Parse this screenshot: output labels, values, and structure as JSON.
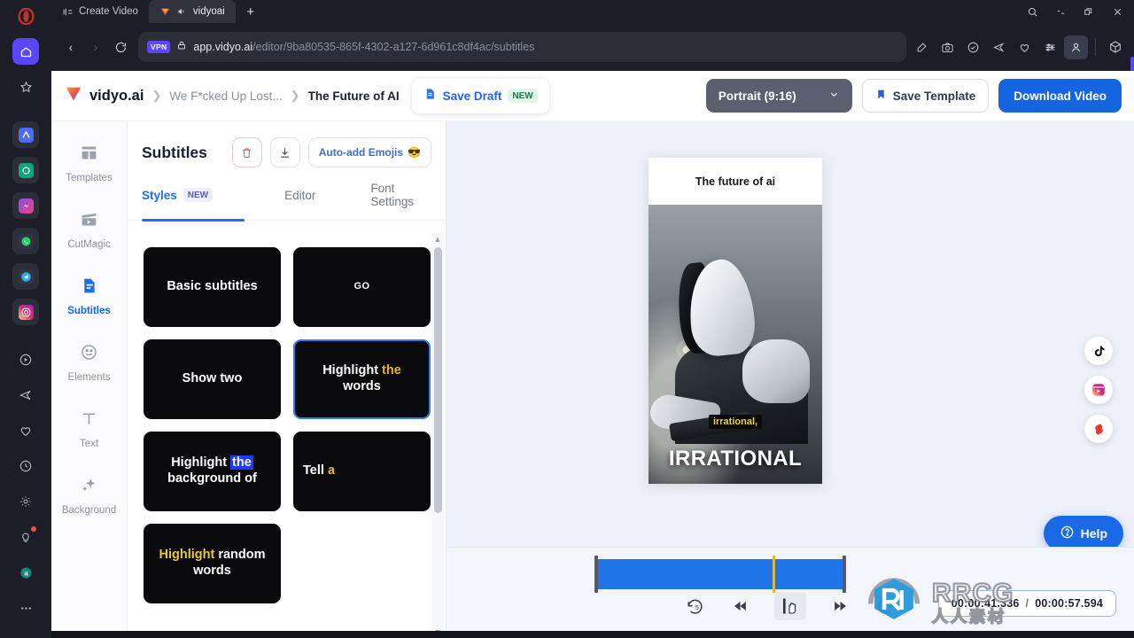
{
  "browser": {
    "tabs": [
      {
        "label": "Create Video",
        "active": false,
        "icon": "media-tab-icon"
      },
      {
        "label": "vidyoai",
        "active": true,
        "icon": "vidyo-favicon"
      }
    ],
    "new_tab_label": "+",
    "window_controls": [
      "search-icon",
      "minimize-icon",
      "maximize-icon",
      "close-icon"
    ],
    "nav": {
      "back": "‹",
      "forward": "›",
      "reload": "reload-icon"
    },
    "vpn_badge": "VPN",
    "url_host": "app.vidyo.ai",
    "url_path": "/editor/9ba80535-865f-4302-a127-6d961c8df4ac/subtitles",
    "toolbar_icons": [
      "edit-icon",
      "camera-icon",
      "shield-check-icon",
      "send-icon",
      "heart-icon",
      "sliders-icon",
      "profile-icon",
      "extensions-cube-icon"
    ],
    "sidebar_icons": [
      "opera-logo-icon",
      "home-icon",
      "star-icon",
      "pinned-app-icon",
      "chatgpt-icon",
      "messenger-icon",
      "whatsapp-icon",
      "telegram-icon",
      "instagram-icon",
      "player-icon",
      "send-icon",
      "heart-icon",
      "history-clock-icon",
      "settings-gear-icon",
      "tips-bulb-icon",
      "aria-icon",
      "more-dots-icon"
    ]
  },
  "header": {
    "brand": "vidyo.ai",
    "breadcrumb": [
      "We F*cked Up Lost...",
      "The Future of AI"
    ],
    "save_draft": "Save Draft",
    "save_draft_badge": "NEW",
    "ratio": "Portrait (9:16)",
    "save_template": "Save Template",
    "download_video": "Download Video"
  },
  "tools": [
    {
      "label": "Templates",
      "icon": "layout-grid-icon",
      "active": false
    },
    {
      "label": "CutMagic",
      "icon": "clapperboard-icon",
      "active": false
    },
    {
      "label": "Subtitles",
      "icon": "subtitles-doc-icon",
      "active": true
    },
    {
      "label": "Elements",
      "icon": "smiley-icon",
      "active": false
    },
    {
      "label": "Text",
      "icon": "text-t-icon",
      "active": false
    },
    {
      "label": "Background",
      "icon": "sparkles-icon",
      "active": false
    }
  ],
  "panel": {
    "title": "Subtitles",
    "delete_icon": "trash-icon",
    "download_icon": "download-icon",
    "emoji_button": "Auto-add Emojis",
    "emoji_glyph": "😎",
    "tabs": [
      {
        "label": "Styles",
        "badge": "NEW",
        "active": true
      },
      {
        "label": "Editor",
        "badge": "",
        "active": false
      },
      {
        "label": "Font Settings",
        "badge": "",
        "active": false
      }
    ],
    "styles": [
      {
        "name": "Basic subtitles",
        "parts": [
          {
            "t": "Basic subtitles",
            "hl": "none"
          }
        ],
        "selected": false,
        "small": false
      },
      {
        "name": "GO",
        "parts": [
          {
            "t": "GO",
            "hl": "none"
          }
        ],
        "selected": false,
        "small": true
      },
      {
        "name": "Show two",
        "parts": [
          {
            "t": "Show two",
            "hl": "none"
          }
        ],
        "selected": false,
        "small": false
      },
      {
        "name": "Highlight the words",
        "parts": [
          {
            "t": "Highlight ",
            "hl": "none"
          },
          {
            "t": "the",
            "hl": "yellow"
          },
          {
            "t": " words",
            "hl": "none"
          }
        ],
        "selected": true,
        "small": false
      },
      {
        "name": "Highlight the background of",
        "parts": [
          {
            "t": "Highlight ",
            "hl": "none"
          },
          {
            "t": "the",
            "hl": "bluebg"
          },
          {
            "t": " background of",
            "hl": "none"
          }
        ],
        "selected": false,
        "small": false
      },
      {
        "name": "Tell a",
        "parts": [
          {
            "t": "Tell ",
            "hl": "none"
          },
          {
            "t": "a",
            "hl": "yellow"
          }
        ],
        "selected": false,
        "small": false,
        "align": "left"
      },
      {
        "name": "Highlight random words",
        "parts": [
          {
            "t": "Highlight",
            "hl": "yellowfull"
          },
          {
            "t": " random words",
            "hl": "none"
          }
        ],
        "selected": false,
        "small": false
      }
    ]
  },
  "preview": {
    "title": "The future of ai",
    "subtitle_small": "irrational,",
    "subtitle_big": "IRRATIONAL",
    "social_icons": [
      "tiktok-icon",
      "instagram-reels-icon",
      "youtube-shorts-icon"
    ],
    "help_label": "Help",
    "help_icon": "question-circle-icon"
  },
  "timeline": {
    "controls": [
      "rewind-5-icon",
      "step-back-icon",
      "split-playhead-icon",
      "step-forward-icon",
      "forward-5-icon"
    ],
    "current_time": "00:00:41.336",
    "total_time": "00:00:57.594",
    "separator": "/"
  },
  "watermark": {
    "line1": "RRCG",
    "line2": "人人素材"
  },
  "colors": {
    "accent_blue": "#1565e0",
    "selection_blue": "#2f7cf0",
    "highlight_yellow": "#e8b521",
    "highlight_bluebg": "#1d3bff",
    "track_blue": "#1f74e8",
    "playhead_gold": "#e0b93a"
  }
}
